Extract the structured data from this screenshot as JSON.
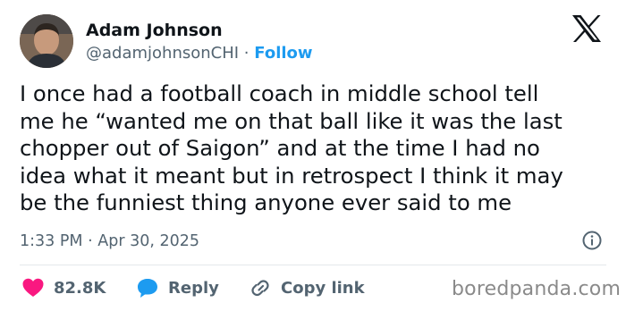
{
  "author": {
    "name": "Adam Johnson",
    "handle": "@adamjohnsonCHI",
    "separator": "·",
    "follow_label": "Follow",
    "avatar": "profile-photo"
  },
  "brand_icon": "x-logo-icon",
  "tweet": {
    "lines": [
      "I once had a football coach in middle school tell",
      "me he “wanted me on that ball like it was the last",
      "chopper out of Saigon” and at the time I had no",
      "idea what it meant but in retrospect I think it may",
      "be the funniest thing anyone ever said to me"
    ]
  },
  "meta": {
    "time": "1:33 PM",
    "separator": "·",
    "date": "Apr 30, 2025",
    "info_icon": "info-icon"
  },
  "actions": {
    "like_count": "82.8K",
    "reply_label": "Reply",
    "copy_label": "Copy link"
  },
  "watermark": "boredpanda.com",
  "colors": {
    "accent": "#1d9bf0",
    "like": "#f91880",
    "text": "#0f1419",
    "muted": "#536471"
  }
}
